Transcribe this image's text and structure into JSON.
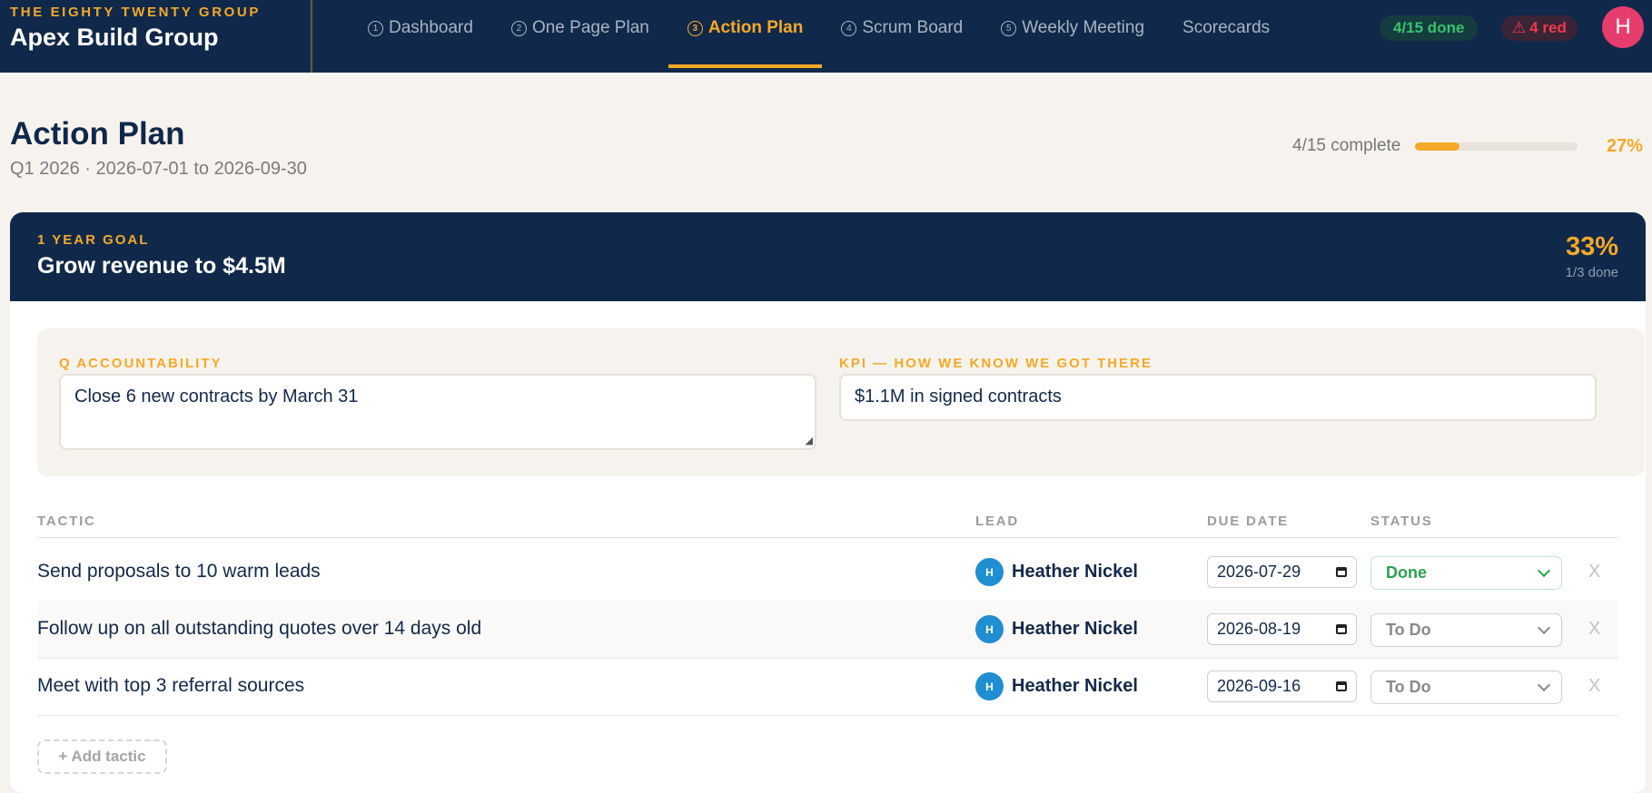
{
  "brand": {
    "company": "THE EIGHTY TWENTY GROUP",
    "org": "Apex Build Group"
  },
  "nav": [
    {
      "num": "1",
      "label": "Dashboard",
      "active": false
    },
    {
      "num": "2",
      "label": "One Page Plan",
      "active": false
    },
    {
      "num": "3",
      "label": "Action Plan",
      "active": true
    },
    {
      "num": "4",
      "label": "Scrum Board",
      "active": false
    },
    {
      "num": "5",
      "label": "Weekly Meeting",
      "active": false
    },
    {
      "num": "",
      "label": "Scorecards",
      "active": false
    }
  ],
  "header": {
    "done_pill": "4/15 done",
    "red_pill_icon": "warning-triangle-icon",
    "red_pill": "4 red",
    "avatar_initial": "H"
  },
  "page": {
    "title": "Action Plan",
    "subtitle": "Q1 2026 · 2026-07-01 to 2026-09-30",
    "progress_label": "4/15 complete",
    "progress_fraction": 0.27,
    "progress_pct": "27%"
  },
  "goal": {
    "kicker": "1 YEAR GOAL",
    "title": "Grow revenue to $4.5M",
    "pct": "33%",
    "done": "1/3 done"
  },
  "accountability": {
    "label": "Q ACCOUNTABILITY",
    "value": "Close 6 new contracts by March 31",
    "kpi_label": "KPI — HOW WE KNOW WE GOT THERE",
    "kpi_value": "$1.1M in signed contracts"
  },
  "table": {
    "headers": {
      "tactic": "TACTIC",
      "lead": "LEAD",
      "due": "DUE DATE",
      "status": "STATUS"
    },
    "rows": [
      {
        "tactic": "Send proposals to 10 warm leads",
        "lead_initial": "H",
        "lead": "Heather Nickel",
        "due": "2026-07-29",
        "status": "Done"
      },
      {
        "tactic": "Follow up on all outstanding quotes over 14 days old",
        "lead_initial": "H",
        "lead": "Heather Nickel",
        "due": "2026-08-19",
        "status": "To Do"
      },
      {
        "tactic": "Meet with top 3 referral sources",
        "lead_initial": "H",
        "lead": "Heather Nickel",
        "due": "2026-09-16",
        "status": "To Do"
      }
    ],
    "delete_label": "X",
    "add_label": "+ Add tactic"
  },
  "colors": {
    "navy": "#10294a",
    "accent": "#f4a928",
    "done_green": "#2aa34e",
    "alert_red": "#ef3b46"
  }
}
